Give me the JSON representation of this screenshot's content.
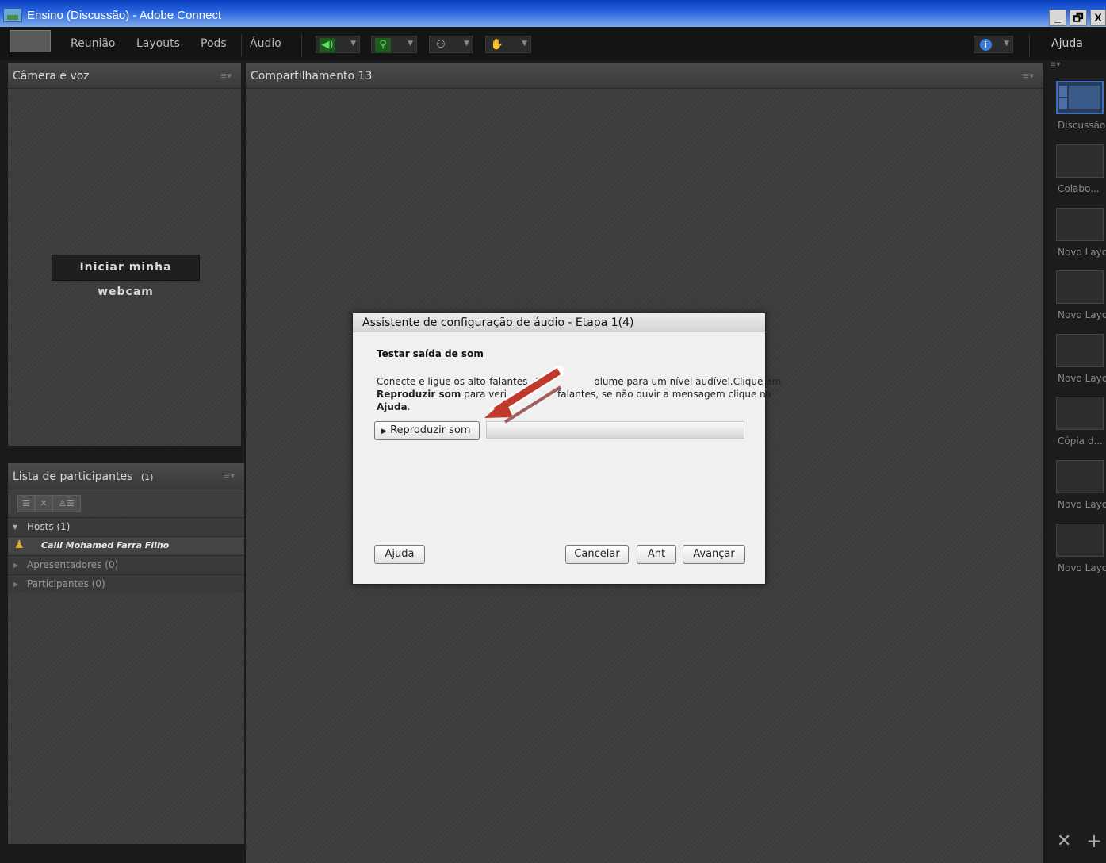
{
  "window": {
    "title": "Ensino (Discussão) - Adobe Connect",
    "controls": [
      "_",
      "🗗",
      "X"
    ]
  },
  "menubar": {
    "items": [
      "Reunião",
      "Layouts",
      "Pods",
      "Áudio"
    ],
    "help": "Ajuda"
  },
  "toolbar": {
    "icons": [
      "speaker-icon",
      "microphone-muted-icon",
      "webcam-icon",
      "raise-hand-icon",
      "info-icon"
    ],
    "colors": {
      "speaker": "#3fbf3f",
      "microphone": "#3fbf3f",
      "webcam": "#c8c8c8",
      "hand": "#c8c8c8",
      "info": "#3b7ce0"
    }
  },
  "camera_pod": {
    "title": "Câmera e voz",
    "webcam_button": "Iniciar minha webcam"
  },
  "share_pod": {
    "title": "Compartilhamento 13"
  },
  "participants_pod": {
    "title": "Lista de participantes",
    "count": "(1)",
    "groups": [
      {
        "label": "Hosts (1)",
        "expanded": true
      },
      {
        "label": "Apresentadores (0)",
        "expanded": false
      },
      {
        "label": "Participantes (0)",
        "expanded": false
      }
    ],
    "host_name": "Calil Mohamed Farra Filho"
  },
  "layouts": {
    "items": [
      "Discussão",
      "Colabo...",
      "Novo Layo",
      "Novo Layo",
      "Novo Layo",
      "Cópia d...",
      "Novo Layo",
      "Novo Layo"
    ],
    "active": "Discussão"
  },
  "dialog": {
    "title": "Assistente de configuração de áudio - Etapa 1(4)",
    "heading": "Testar saída de som",
    "line1_a": "Conecte e ligue os alto-falantes. A",
    "line1_b": "olume para um nível audível.Clique em",
    "line2_bold": "Reproduzir som",
    "line2_a": " para veri",
    "line2_b": "falantes, se não ouvir a mensagem clique na",
    "line3_bold": "Ajuda",
    "line3_tail": ".",
    "play_button": "Reproduzir som",
    "help_button": "Ajuda",
    "cancel_button": "Cancelar",
    "back_button": "Ant",
    "next_button": "Avançar",
    "arrow_color": "#c0392b"
  }
}
